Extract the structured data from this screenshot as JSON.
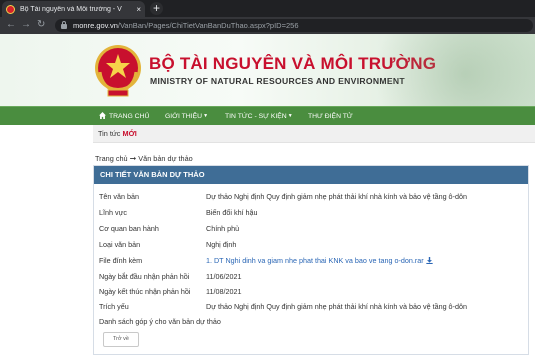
{
  "browser": {
    "tab_title": "Bộ Tài nguyên và Môi trường - V",
    "tab_close": "×",
    "new_tab": "+",
    "url_domain": "monre.gov.vn",
    "url_path": "/VanBan/Pages/ChiTietVanBanDuThao.aspx?pID=256"
  },
  "site": {
    "title": "BỘ TÀI NGUYÊN VÀ MÔI TRƯỜNG",
    "subtitle": "MINISTRY OF NATURAL RESOURCES AND ENVIRONMENT",
    "brand_red": "#c8102e",
    "menu_green": "#4a8d3f"
  },
  "menu": {
    "items": [
      {
        "label": "TRANG CHỦ"
      },
      {
        "label": "GIỚI THIỆU"
      },
      {
        "label": "TIN TỨC - SỰ KIỆN"
      },
      {
        "label": "THƯ ĐIỆN TỬ"
      }
    ]
  },
  "news": {
    "label": "Tin tức",
    "highlight": "MỚI"
  },
  "breadcrumb": {
    "home": "Trang chủ",
    "current": "Văn bản dự thảo"
  },
  "detail": {
    "header": "CHI TIẾT VĂN BẢN DỰ THẢO",
    "rows": [
      {
        "key": "Tên văn bản",
        "value": "Dự thảo Nghị định Quy định giảm nhẹ phát thải khí nhà kính và bảo vệ tầng ô-dôn"
      },
      {
        "key": "Lĩnh vực",
        "value": "Biến đổi khí hậu"
      },
      {
        "key": "Cơ quan ban hành",
        "value": "Chính phủ"
      },
      {
        "key": "Loại văn bản",
        "value": "Nghị định"
      },
      {
        "key": "File đính kèm",
        "value": "1. DT Nghi dinh va giam nhe phat thai KNK va bao ve tang o-don.rar"
      },
      {
        "key": "Ngày bắt đầu nhận phản hồi",
        "value": "11/06/2021"
      },
      {
        "key": "Ngày kết thúc nhận phản hồi",
        "value": "11/08/2021"
      },
      {
        "key": "Trích yếu",
        "value": "Dự thảo Nghị định Quy định giảm nhẹ phát thải khí nhà kính và bảo vệ tầng ô-dôn"
      },
      {
        "key": "Danh sách góp ý cho văn bản dự thảo",
        "value": ""
      }
    ],
    "back_button": "Trở về"
  }
}
